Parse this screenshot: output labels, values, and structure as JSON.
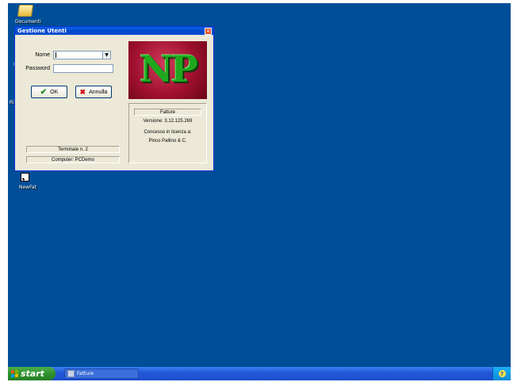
{
  "desktop": {
    "icons": [
      {
        "label": "Documenti"
      },
      {
        "label": "NewFat"
      }
    ],
    "partial_texts": [
      "F",
      "Ris"
    ]
  },
  "taskbar": {
    "start_label": "start",
    "tasks": [
      {
        "label": "Fatture"
      }
    ]
  },
  "dialog": {
    "title": "Gestione Utenti",
    "nome_label": "Nome",
    "password_label": "Password",
    "nome_value": "",
    "password_value": "",
    "ok_label": "OK",
    "annulla_label": "Annulla",
    "terminale": "Terminale n. 2",
    "computer": "Computer: PCDemo",
    "logo_text": "NP",
    "app_name": "Fatture",
    "version": "Versione: 3.12.125.269",
    "license_label": "Concesso in licenza a:",
    "licensee": "Pinco Pallino & C."
  },
  "colors": {
    "desktop_bg": "#004e98",
    "titlebar": "#0047c8",
    "dialog_bg": "#ece9d8",
    "logo_bg": "#a01030",
    "logo_text": "#1fa81f"
  }
}
